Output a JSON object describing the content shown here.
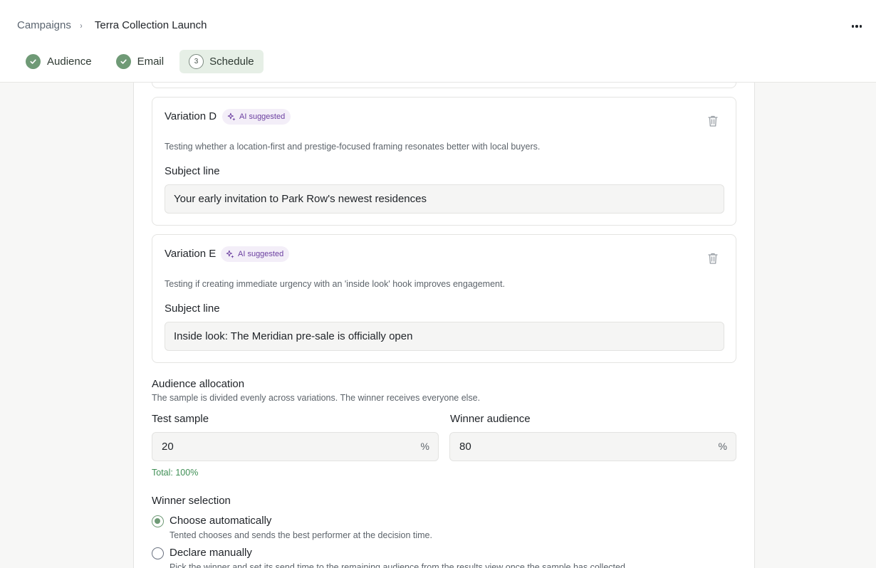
{
  "breadcrumb": {
    "parent": "Campaigns",
    "separator": "›",
    "current": "Terra Collection Launch"
  },
  "steps": [
    {
      "label": "Audience",
      "status": "complete"
    },
    {
      "label": "Email",
      "status": "complete"
    },
    {
      "number": "3",
      "label": "Schedule",
      "status": "active"
    }
  ],
  "variations": [
    {
      "title": "Variation D",
      "badge": "AI suggested",
      "description": "Testing whether a location-first and prestige-focused framing resonates better with local buyers.",
      "subject_label": "Subject line",
      "subject_value": "Your early invitation to Park Row's newest residences"
    },
    {
      "title": "Variation E",
      "badge": "AI suggested",
      "description": "Testing if creating immediate urgency with an 'inside look' hook improves engagement.",
      "subject_label": "Subject line",
      "subject_value": "Inside look: The Meridian pre-sale is officially open"
    }
  ],
  "allocation": {
    "title": "Audience allocation",
    "subtitle": "The sample is divided evenly across variations. The winner receives everyone else.",
    "test_sample": {
      "label": "Test sample",
      "value": "20",
      "unit": "%"
    },
    "winner_audience": {
      "label": "Winner audience",
      "value": "80",
      "unit": "%"
    },
    "total": "Total: 100%"
  },
  "winner_selection": {
    "title": "Winner selection",
    "options": [
      {
        "label": "Choose automatically",
        "description": "Tented chooses and sends the best performer at the decision time.",
        "selected": true
      },
      {
        "label": "Declare manually",
        "description": "Pick the winner and set its send time to the remaining audience from the results view once the sample has collected.",
        "selected": false
      }
    ]
  },
  "colors": {
    "accent_green": "#6f9a76",
    "ai_purple": "#6b3fa0",
    "total_green": "#3f8f55"
  }
}
